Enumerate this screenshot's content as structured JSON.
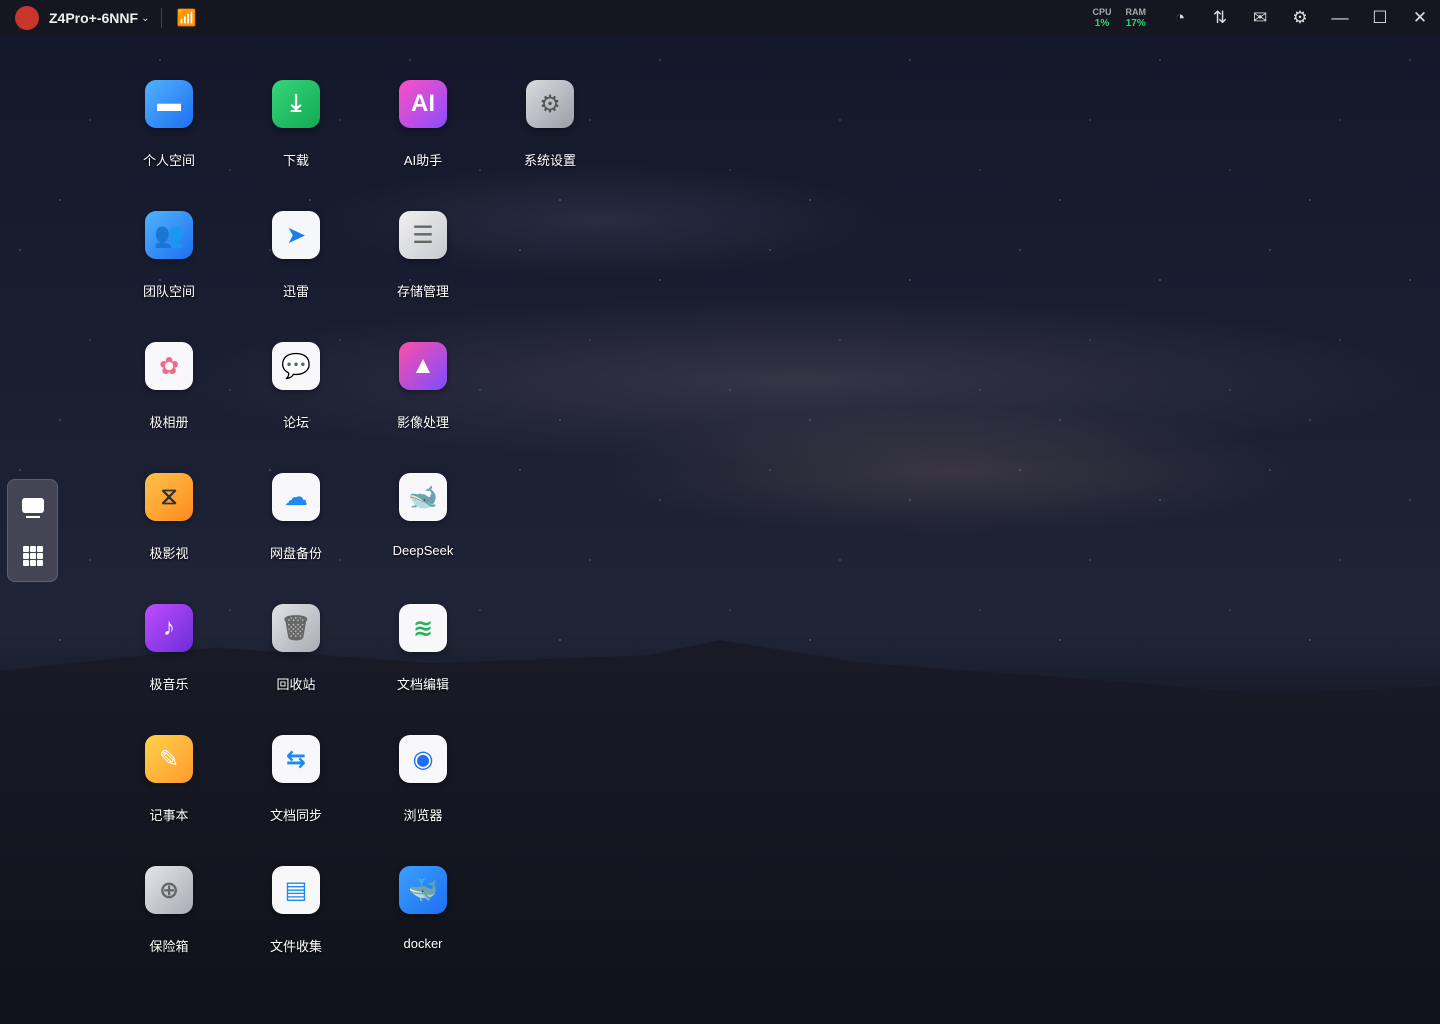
{
  "titlebar": {
    "device_name": "Z4Pro+-6NNF",
    "cpu_label": "CPU",
    "cpu_value": "1%",
    "ram_label": "RAM",
    "ram_value": "17%"
  },
  "apps": [
    {
      "label": "个人空间",
      "icon": "folder-icon",
      "bg": "linear-gradient(135deg,#4fb3ff,#1e6ff0)",
      "glyph": "▬",
      "fg": "#fff"
    },
    {
      "label": "下载",
      "icon": "download-icon",
      "bg": "linear-gradient(135deg,#36d67a,#12a954)",
      "glyph": "⤓",
      "fg": "#fff"
    },
    {
      "label": "AI助手",
      "icon": "ai-assistant-icon",
      "bg": "linear-gradient(135deg,#ff4fc3,#8a4dff)",
      "glyph": "AI",
      "fg": "#fff"
    },
    {
      "label": "系统设置",
      "icon": "settings-icon",
      "bg": "linear-gradient(135deg,#d9dbe0,#9a9ea6)",
      "glyph": "⚙",
      "fg": "#555"
    },
    {
      "label": "团队空间",
      "icon": "team-folder-icon",
      "bg": "linear-gradient(135deg,#4fb3ff,#1e6ff0)",
      "glyph": "👥",
      "fg": "#fff"
    },
    {
      "label": "迅雷",
      "icon": "xunlei-icon",
      "bg": "#f5f7fb",
      "glyph": "➤",
      "fg": "#1e7bf0"
    },
    {
      "label": "存储管理",
      "icon": "storage-icon",
      "bg": "linear-gradient(135deg,#f0f0f2,#c8cad0)",
      "glyph": "☰",
      "fg": "#666"
    },
    {
      "label": "极相册",
      "icon": "photos-icon",
      "bg": "#f8f8fa",
      "glyph": "✿",
      "fg": "#f06a8a"
    },
    {
      "label": "论坛",
      "icon": "forum-icon",
      "bg": "#f8f8fa",
      "glyph": "💬",
      "fg": "#f07a30"
    },
    {
      "label": "影像处理",
      "icon": "image-processing-icon",
      "bg": "linear-gradient(135deg,#ff4fa8,#7a4dff)",
      "glyph": "▲",
      "fg": "#fff"
    },
    {
      "label": "极影视",
      "icon": "video-icon",
      "bg": "linear-gradient(135deg,#ffc24a,#ff8a1e)",
      "glyph": "⧖",
      "fg": "#333"
    },
    {
      "label": "网盘备份",
      "icon": "cloud-backup-icon",
      "bg": "#f8f8fa",
      "glyph": "☁",
      "fg": "#1e8af0"
    },
    {
      "label": "DeepSeek",
      "icon": "deepseek-icon",
      "bg": "#f8f8fa",
      "glyph": "🐋",
      "fg": "#3b6cf0"
    },
    {
      "label": "极音乐",
      "icon": "music-icon",
      "bg": "linear-gradient(135deg,#c04dff,#6a2dd8)",
      "glyph": "♪",
      "fg": "#fff"
    },
    {
      "label": "回收站",
      "icon": "trash-icon",
      "bg": "linear-gradient(135deg,#e0e2e6,#a8acb4)",
      "glyph": "🗑",
      "fg": "#666"
    },
    {
      "label": "文档编辑",
      "icon": "document-edit-icon",
      "bg": "#f8f8fa",
      "glyph": "≋",
      "fg": "#2bb35a"
    },
    {
      "label": "记事本",
      "icon": "notepad-icon",
      "bg": "linear-gradient(135deg,#ffd24a,#ff9a2e)",
      "glyph": "✎",
      "fg": "#fff"
    },
    {
      "label": "文档同步",
      "icon": "document-sync-icon",
      "bg": "#f8f8fa",
      "glyph": "⇆",
      "fg": "#1e8af0"
    },
    {
      "label": "浏览器",
      "icon": "browser-icon",
      "bg": "#f8f8fa",
      "glyph": "◉",
      "fg": "#1e6ff0"
    },
    {
      "label": "保险箱",
      "icon": "safe-icon",
      "bg": "linear-gradient(135deg,#e4e6ea,#a8acb4)",
      "glyph": "⊕",
      "fg": "#666"
    },
    {
      "label": "文件收集",
      "icon": "file-collect-icon",
      "bg": "#f8f8fa",
      "glyph": "▤",
      "fg": "#1e8af0"
    },
    {
      "label": "docker",
      "icon": "docker-icon",
      "bg": "linear-gradient(135deg,#3aa0ff,#1e6ff0)",
      "glyph": "🐳",
      "fg": "#fff"
    }
  ]
}
